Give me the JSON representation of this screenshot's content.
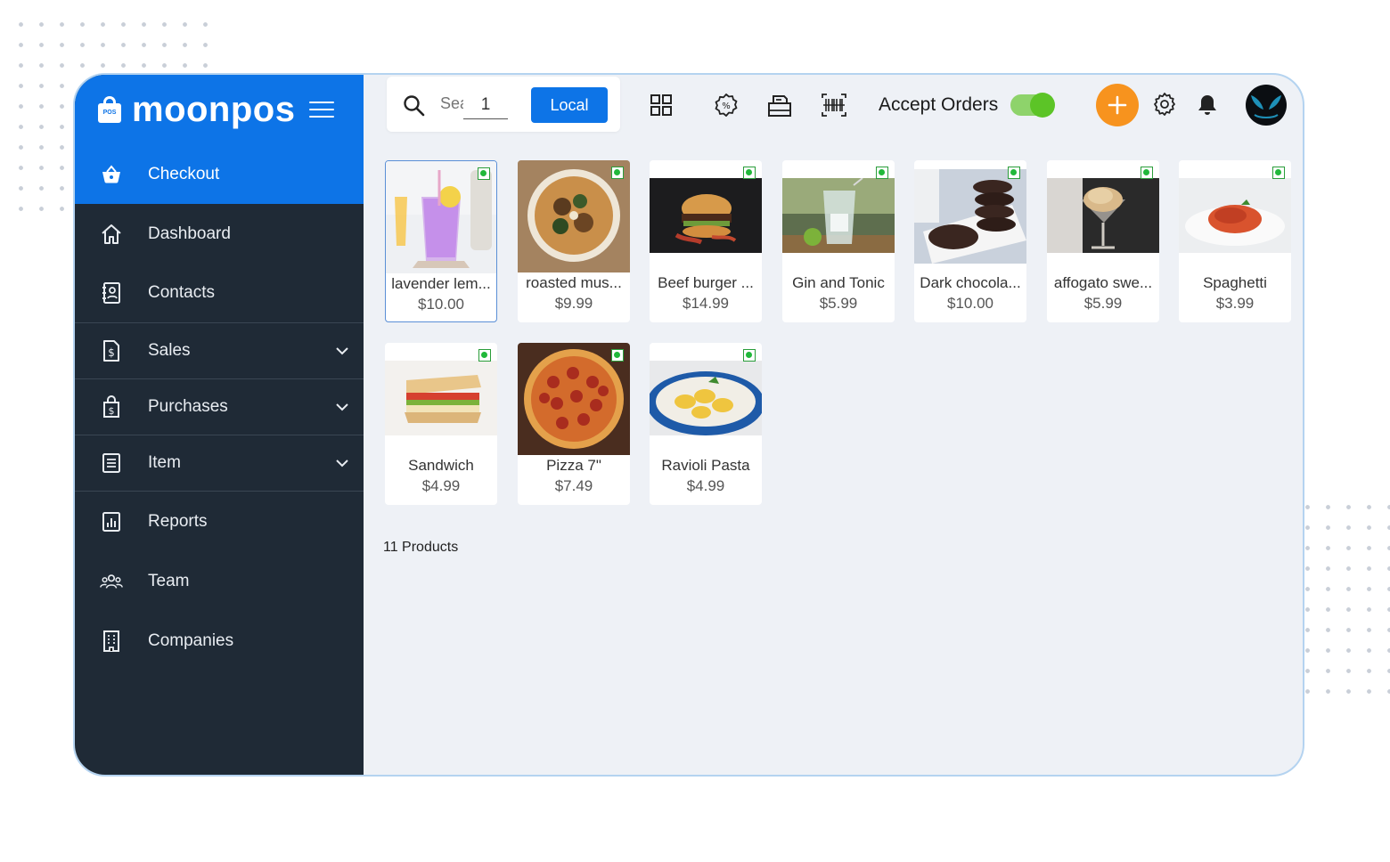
{
  "brand": {
    "name": "moonpos",
    "logo_text": "POS"
  },
  "sidebar": {
    "items": [
      {
        "label": "Checkout",
        "icon": "basket-icon",
        "active": true
      },
      {
        "label": "Dashboard",
        "icon": "home-icon"
      },
      {
        "label": "Contacts",
        "icon": "contacts-book-icon"
      },
      {
        "label": "Sales",
        "icon": "invoice-dollar-icon",
        "expandable": true
      },
      {
        "label": "Purchases",
        "icon": "shopping-bag-dollar-icon",
        "expandable": true
      },
      {
        "label": "Item",
        "icon": "list-icon",
        "expandable": true
      },
      {
        "label": "Reports",
        "icon": "bar-chart-icon"
      },
      {
        "label": "Team",
        "icon": "team-icon"
      },
      {
        "label": "Companies",
        "icon": "building-icon"
      }
    ]
  },
  "topbar": {
    "search_placeholder": "Search",
    "quantity": "1",
    "local_label": "Local",
    "accept_orders_label": "Accept Orders",
    "accept_orders_on": true
  },
  "products": [
    {
      "name": "lavender lem...",
      "price": "$10.00",
      "image": "lavender-lemonade",
      "selected": true
    },
    {
      "name": "roasted mus...",
      "price": "$9.99",
      "image": "roasted-mushroom-bowl"
    },
    {
      "name": "Beef burger ...",
      "price": "$14.99",
      "image": "beef-burger"
    },
    {
      "name": "Gin and Tonic",
      "price": "$5.99",
      "image": "gin-and-tonic"
    },
    {
      "name": "Dark chocola...",
      "price": "$10.00",
      "image": "dark-chocolate-cookies"
    },
    {
      "name": "affogato swe...",
      "price": "$5.99",
      "image": "affogato"
    },
    {
      "name": "Spaghetti",
      "price": "$3.99",
      "image": "spaghetti"
    },
    {
      "name": "Sandwich",
      "price": "$4.99",
      "image": "sandwich"
    },
    {
      "name": "Pizza 7\"",
      "price": "$7.49",
      "image": "pepperoni-pizza"
    },
    {
      "name": "Ravioli Pasta",
      "price": "$4.99",
      "image": "ravioli-pasta"
    }
  ],
  "product_count": "11 Products",
  "colors": {
    "primary": "#0d74e7",
    "sidebar": "#1f2a36",
    "accent_orange": "#f7931e",
    "toggle_green": "#5cc427",
    "veg_green": "#21b83a"
  }
}
